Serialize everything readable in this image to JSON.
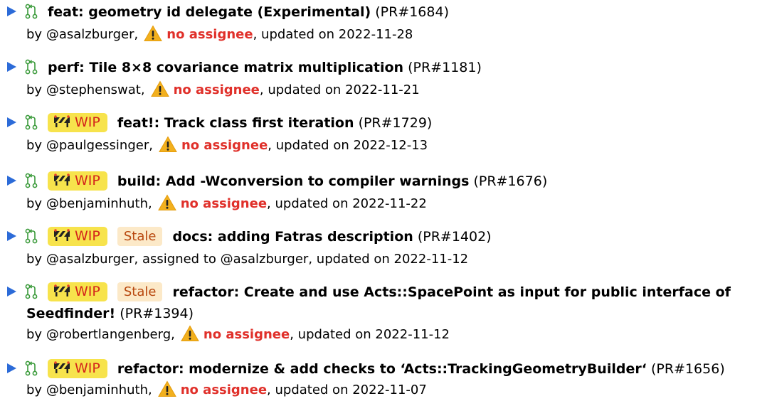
{
  "colors": {
    "triangle": "#2c6bd8",
    "pr_icon": "#3a9a3a",
    "wip_bg": "#f7e34c",
    "wip_text": "#d4251c",
    "stale_bg": "#fce9c8",
    "stale_text": "#b8470e",
    "no_assignee": "#e0302a",
    "warning": "#f2b01e"
  },
  "labels": {
    "wip": "WIP",
    "stale": "Stale",
    "by": "by",
    "updated_on": "updated on",
    "no_assignee": "no assignee",
    "assigned_to": "assigned to"
  },
  "pull_requests": [
    {
      "title": "feat: geometry id delegate (Experimental)",
      "number": "(PR#1684)",
      "author": "@asalzburger",
      "assignee_text": "no assignee",
      "updated": "2022-11-28"
    },
    {
      "title": "perf: Tile 8×8 covariance matrix multiplication",
      "number": "(PR#1181)",
      "author": "@stephenswat",
      "assignee_text": "no assignee",
      "updated": "2022-11-21"
    },
    {
      "title": "feat!: Track class first iteration",
      "number": "(PR#1729)",
      "author": "@paulgessinger",
      "assignee_text": "no assignee",
      "updated": "2022-12-13"
    },
    {
      "title": "build: Add -Wconversion to compiler warnings",
      "number": "(PR#1676)",
      "author": "@benjaminhuth",
      "assignee_text": "no assignee",
      "updated": "2022-11-22"
    },
    {
      "title": "docs: adding Fatras description",
      "number": "(PR#1402)",
      "author": "@asalzburger",
      "assignee_text": "assigned to @asalzburger",
      "updated": "2022-11-12"
    },
    {
      "title_line1": "refactor: Create and use Acts::SpacePoint as input for public interface of",
      "title_line2": "Seedfinder!",
      "number": "(PR#1394)",
      "author": "@robertlangenberg",
      "assignee_text": "no assignee",
      "updated": "2022-11-12"
    },
    {
      "title": "refactor: modernize & add checks to ‘Acts::TrackingGeometryBuilder‘",
      "number": "(PR#1656)",
      "author": "@benjaminhuth",
      "assignee_text": "no assignee",
      "updated": "2022-11-07"
    }
  ]
}
